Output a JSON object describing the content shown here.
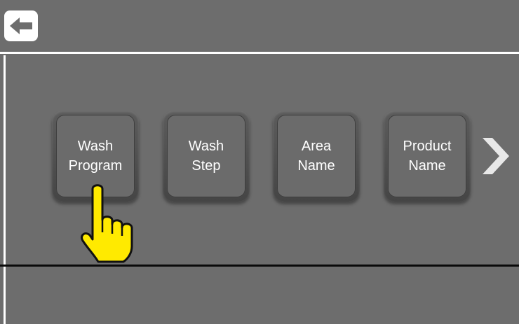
{
  "colors": {
    "background": "#6d6d6d",
    "divider_white": "#ffffff",
    "divider_black": "#0a0a0a",
    "tile_face": "#6b6b6b",
    "label": "#ffffff",
    "hand_fill": "#ffea00"
  },
  "header": {
    "back_icon": "arrow-left-icon"
  },
  "menu": {
    "tiles": [
      {
        "line1": "Wash",
        "line2": "Program"
      },
      {
        "line1": "Wash",
        "line2": "Step"
      },
      {
        "line1": "Area",
        "line2": "Name"
      },
      {
        "line1": "Product",
        "line2": "Name"
      }
    ],
    "next_icon": "chevron-right-icon"
  },
  "overlay": {
    "pointer_icon": "pointing-hand-icon"
  }
}
